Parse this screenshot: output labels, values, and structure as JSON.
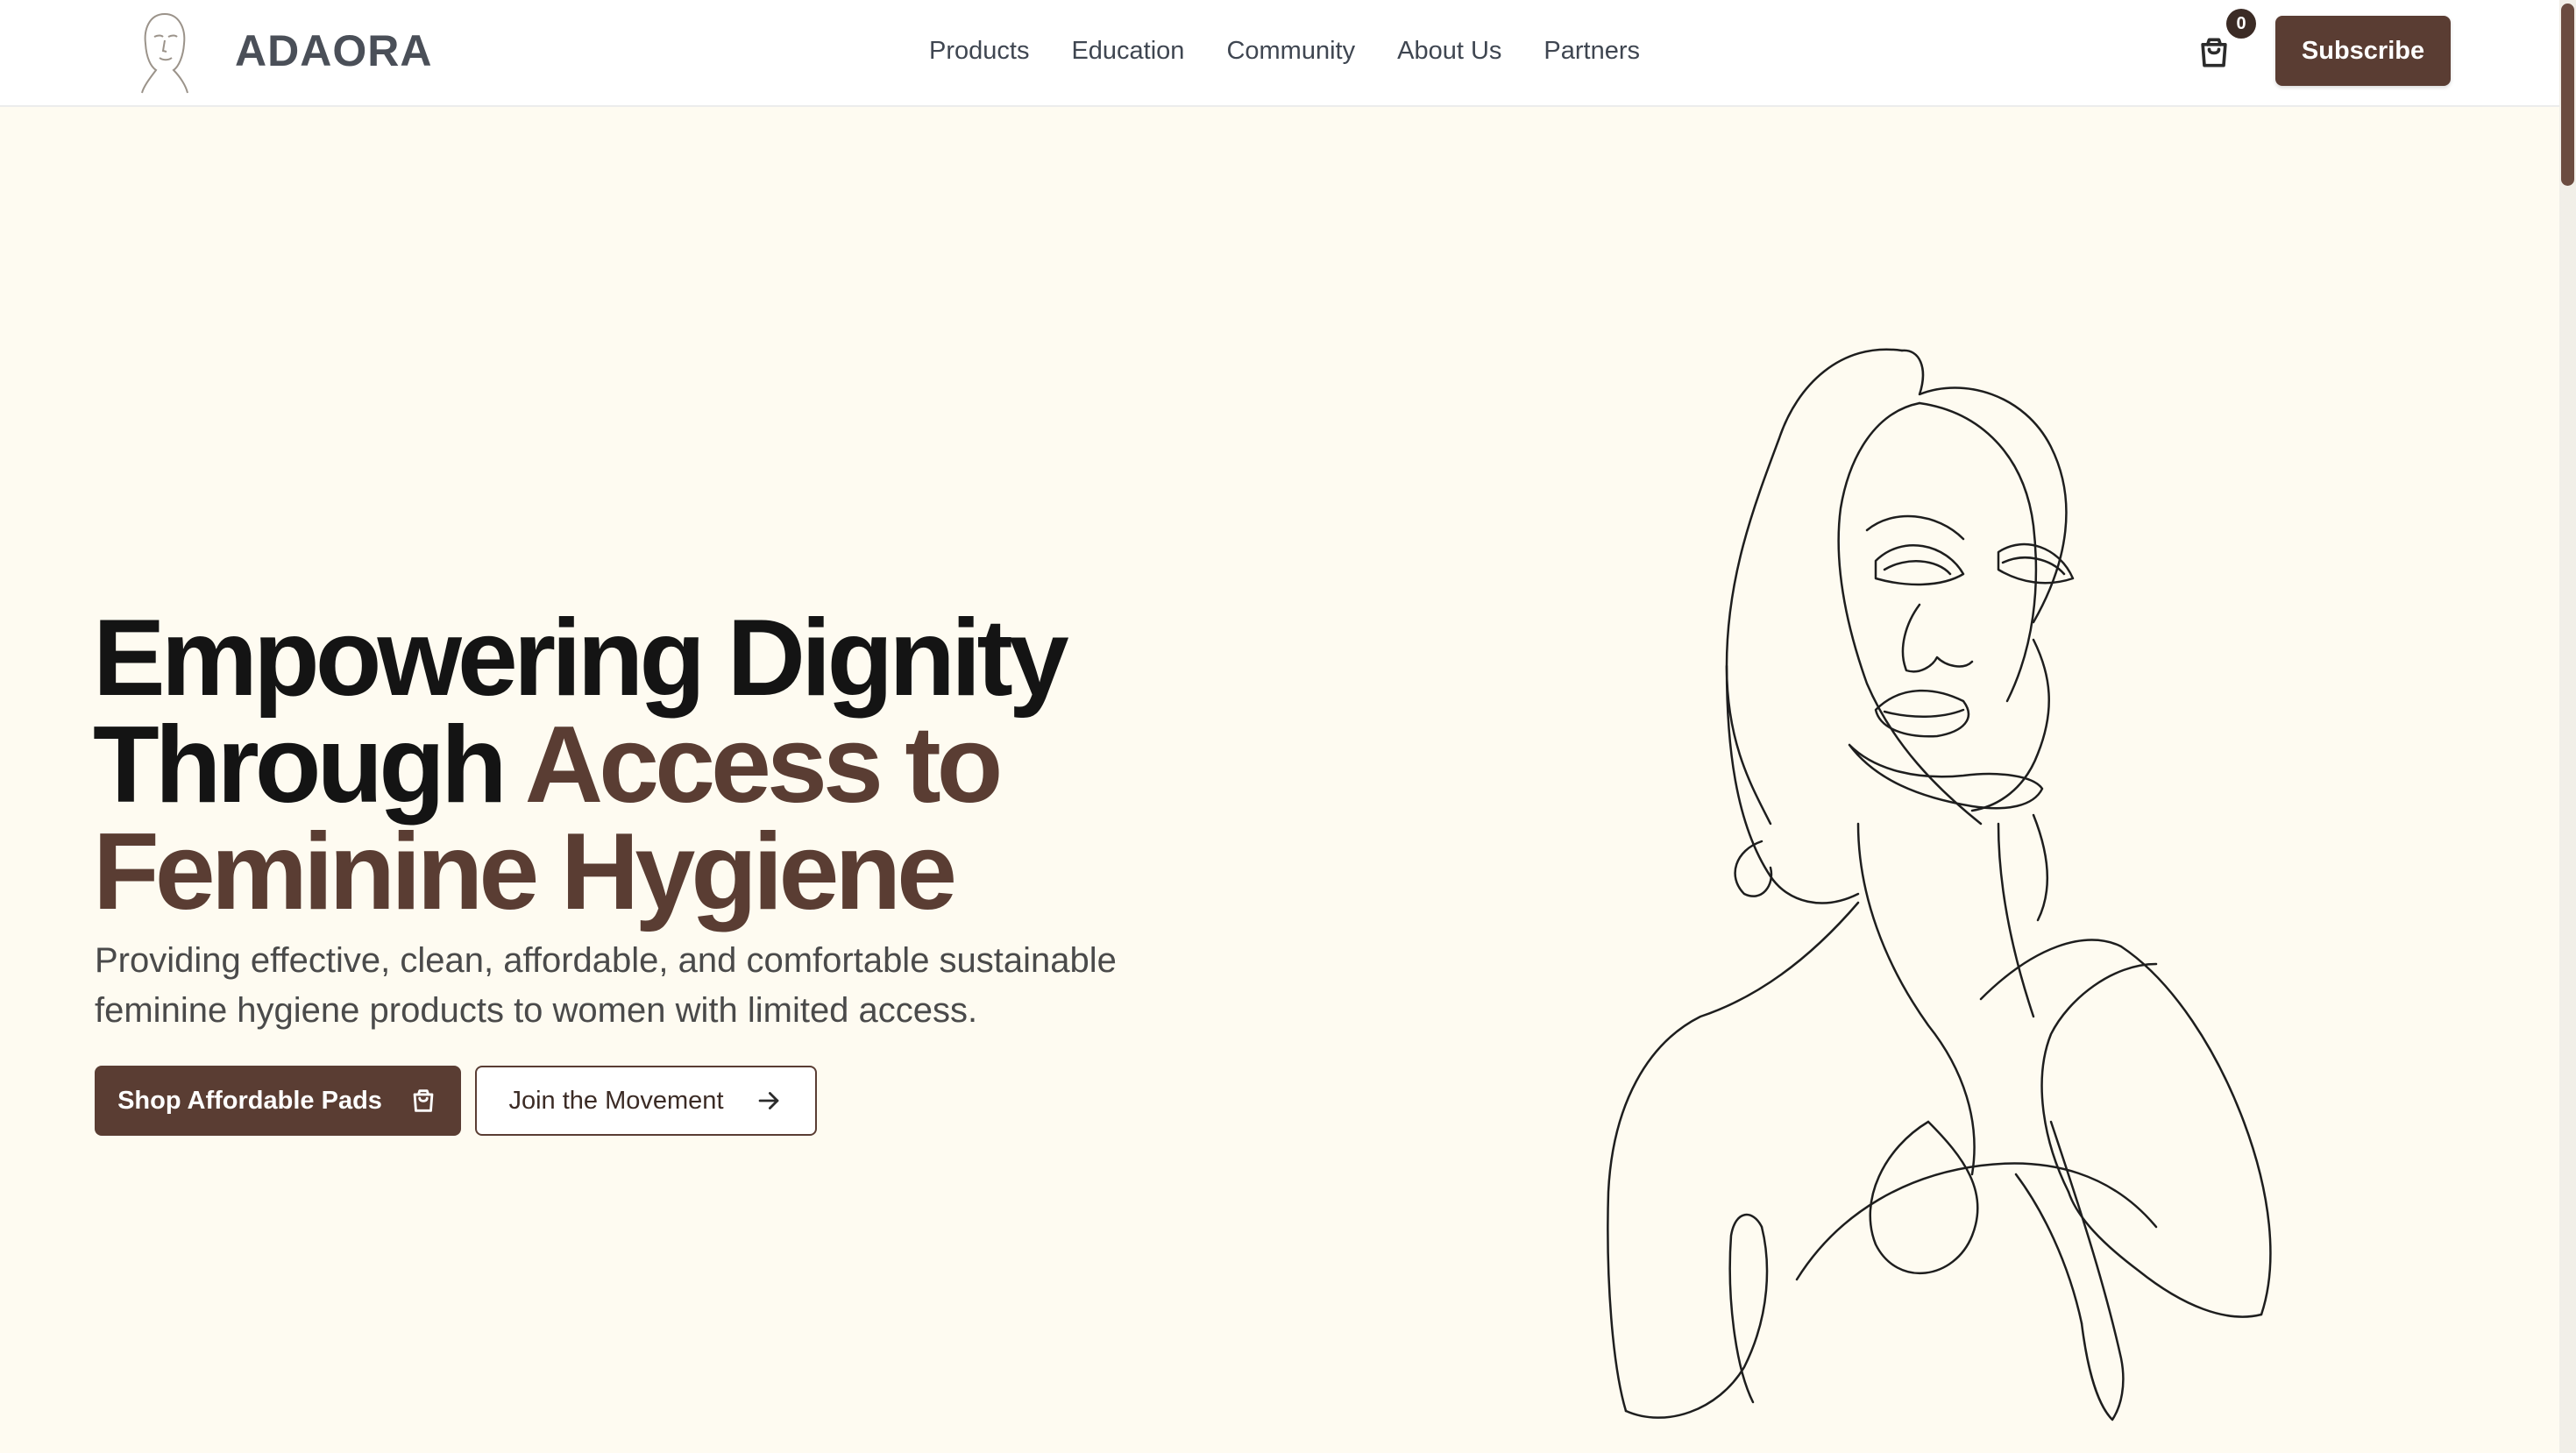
{
  "header": {
    "brand": "ADAORA",
    "nav": [
      {
        "label": "Products"
      },
      {
        "label": "Education"
      },
      {
        "label": "Community"
      },
      {
        "label": "About Us"
      },
      {
        "label": "Partners"
      }
    ],
    "cart_count": "0",
    "subscribe_label": "Subscribe"
  },
  "hero": {
    "headline_part1": "Empowering Dignity Through ",
    "headline_accent": "Access to Feminine Hygiene",
    "subtext": "Providing effective, clean, affordable, and comfortable sustainable feminine hygiene products to women with limited access.",
    "primary_button": {
      "label": "Shop Affordable Pads",
      "icon": "shopping-bag-icon"
    },
    "secondary_button": {
      "label": "Join the Movement",
      "icon": "arrow-right-icon"
    },
    "illustration": "line-art-woman-face-illustration"
  },
  "colors": {
    "accent": "#5a3d33",
    "background": "#fefbf1",
    "header_bg": "#ffffff",
    "badge": "#3b2b25",
    "text_dark": "#141414",
    "text_muted": "#4a4a4a"
  }
}
